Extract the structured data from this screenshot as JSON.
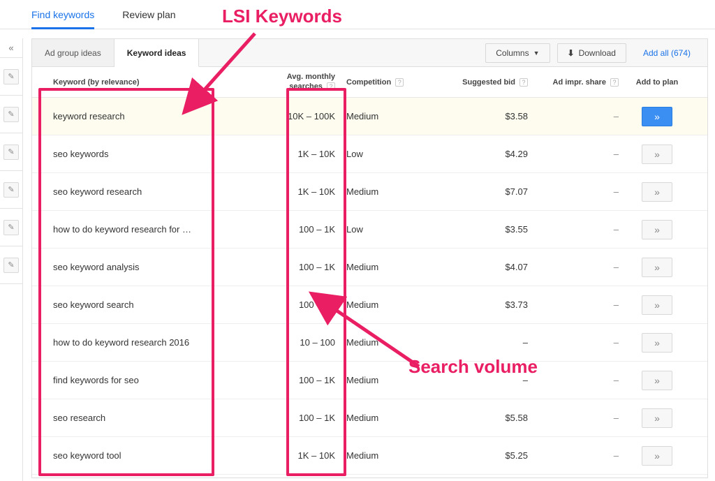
{
  "nav": {
    "find": "Find keywords",
    "review": "Review plan"
  },
  "tabs": {
    "ad_group": "Ad group ideas",
    "keyword": "Keyword ideas"
  },
  "actions": {
    "columns": "Columns",
    "download": "Download",
    "add_all": "Add all (674)"
  },
  "columns": {
    "keyword": "Keyword (by relevance)",
    "search_line1": "Avg. monthly",
    "search_line2": "searches",
    "competition": "Competition",
    "bid": "Suggested bid",
    "impr": "Ad impr. share",
    "add": "Add to plan"
  },
  "rows": [
    {
      "kw": "keyword research",
      "search": "10K – 100K",
      "comp": "Medium",
      "bid": "$3.58",
      "impr": "–",
      "hl": true
    },
    {
      "kw": "seo keywords",
      "search": "1K – 10K",
      "comp": "Low",
      "bid": "$4.29",
      "impr": "–",
      "hl": false
    },
    {
      "kw": "seo keyword research",
      "search": "1K – 10K",
      "comp": "Medium",
      "bid": "$7.07",
      "impr": "–",
      "hl": false
    },
    {
      "kw": "how to do keyword research for …",
      "search": "100 – 1K",
      "comp": "Low",
      "bid": "$3.55",
      "impr": "–",
      "hl": false
    },
    {
      "kw": "seo keyword analysis",
      "search": "100 – 1K",
      "comp": "Medium",
      "bid": "$4.07",
      "impr": "–",
      "hl": false
    },
    {
      "kw": "seo keyword search",
      "search": "100 – 1K",
      "comp": "Medium",
      "bid": "$3.73",
      "impr": "–",
      "hl": false
    },
    {
      "kw": "how to do keyword research 2016",
      "search": "10 – 100",
      "comp": "Medium",
      "bid": "–",
      "impr": "–",
      "hl": false
    },
    {
      "kw": "find keywords for seo",
      "search": "100 – 1K",
      "comp": "Medium",
      "bid": "–",
      "impr": "–",
      "hl": false
    },
    {
      "kw": "seo research",
      "search": "100 – 1K",
      "comp": "Medium",
      "bid": "$5.58",
      "impr": "–",
      "hl": false
    },
    {
      "kw": "seo keyword tool",
      "search": "1K – 10K",
      "comp": "Medium",
      "bid": "$5.25",
      "impr": "–",
      "hl": false
    }
  ],
  "annotations": {
    "lsi": "LSI Keywords",
    "volume": "Search volume"
  },
  "glyphs": {
    "collapse": "«",
    "pencil": "✎",
    "help": "?",
    "chev_right": "»",
    "caret_down": "▼",
    "download": "⬇"
  }
}
